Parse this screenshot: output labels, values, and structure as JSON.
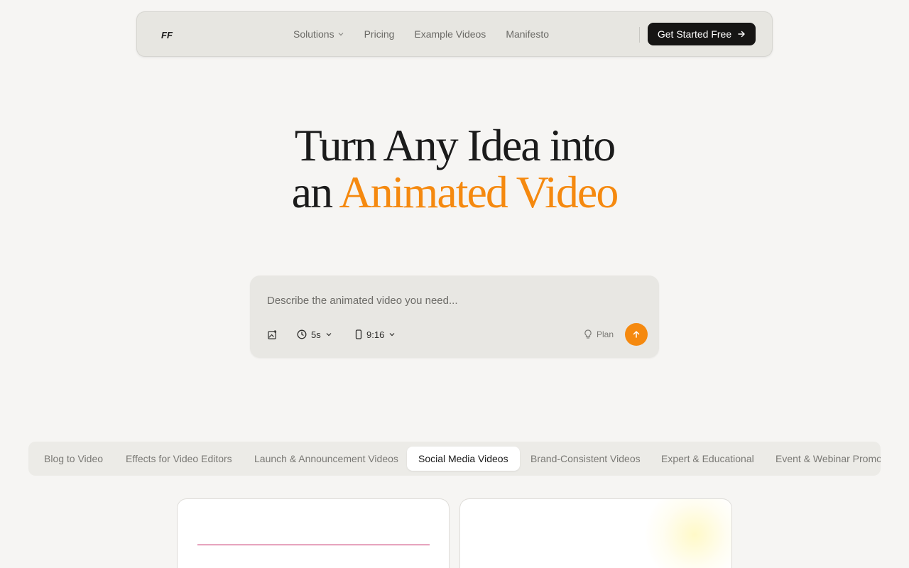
{
  "nav": {
    "logo_text": "FF",
    "links": [
      {
        "label": "Solutions",
        "has_dropdown": true
      },
      {
        "label": "Pricing"
      },
      {
        "label": "Example Videos"
      },
      {
        "label": "Manifesto"
      }
    ],
    "cta_label": "Get Started Free"
  },
  "hero": {
    "line1": "Turn Any Idea into",
    "line2_prefix": "an",
    "line2_accent": "Animated Video"
  },
  "prompt": {
    "placeholder": "Describe the animated video you need...",
    "duration": "5s",
    "aspect_ratio": "9:16",
    "plan_label": "Plan"
  },
  "tabs": [
    {
      "label": "Blog to Video",
      "active": false
    },
    {
      "label": "Effects for Video Editors",
      "active": false
    },
    {
      "label": "Launch & Announcement Videos",
      "active": false
    },
    {
      "label": "Social Media Videos",
      "active": true
    },
    {
      "label": "Brand-Consistent Videos",
      "active": false
    },
    {
      "label": "Expert & Educational",
      "active": false
    },
    {
      "label": "Event & Webinar Promos",
      "active": false
    }
  ],
  "colors": {
    "accent": "#f5890f",
    "background": "#f6f5f3",
    "cta_background": "#161514",
    "card_line": "#c2185b"
  }
}
